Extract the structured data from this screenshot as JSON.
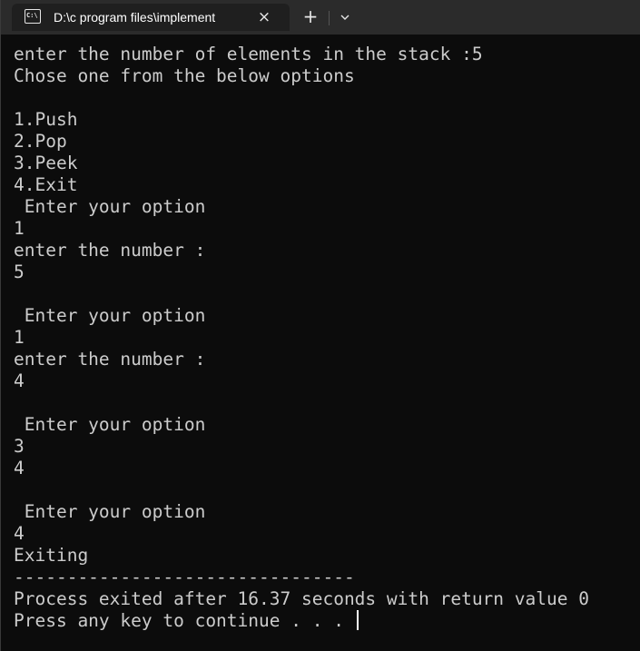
{
  "tab": {
    "icon_text": "C:\\",
    "title": "D:\\c program files\\implement",
    "close_symbol": "×",
    "new_tab_symbol": "+",
    "dropdown_icon": "chevron-down-icon"
  },
  "terminal": {
    "lines": [
      "enter the number of elements in the stack :5",
      "Chose one from the below options",
      "",
      "1.Push",
      "2.Pop",
      "3.Peek",
      "4.Exit",
      " Enter your option",
      "1",
      "enter the number :",
      "5",
      "",
      " Enter your option",
      "1",
      "enter the number :",
      "4",
      "",
      " Enter your option",
      "3",
      "4",
      "",
      " Enter your option",
      "4",
      "Exiting",
      "--------------------------------",
      "Process exited after 16.37 seconds with return value 0",
      "Press any key to continue . . . "
    ]
  },
  "colors": {
    "background": "#0c0c0c",
    "text": "#cccccc",
    "tabbar": "#2b2b2b",
    "active_tab": "#1f1f1f"
  }
}
